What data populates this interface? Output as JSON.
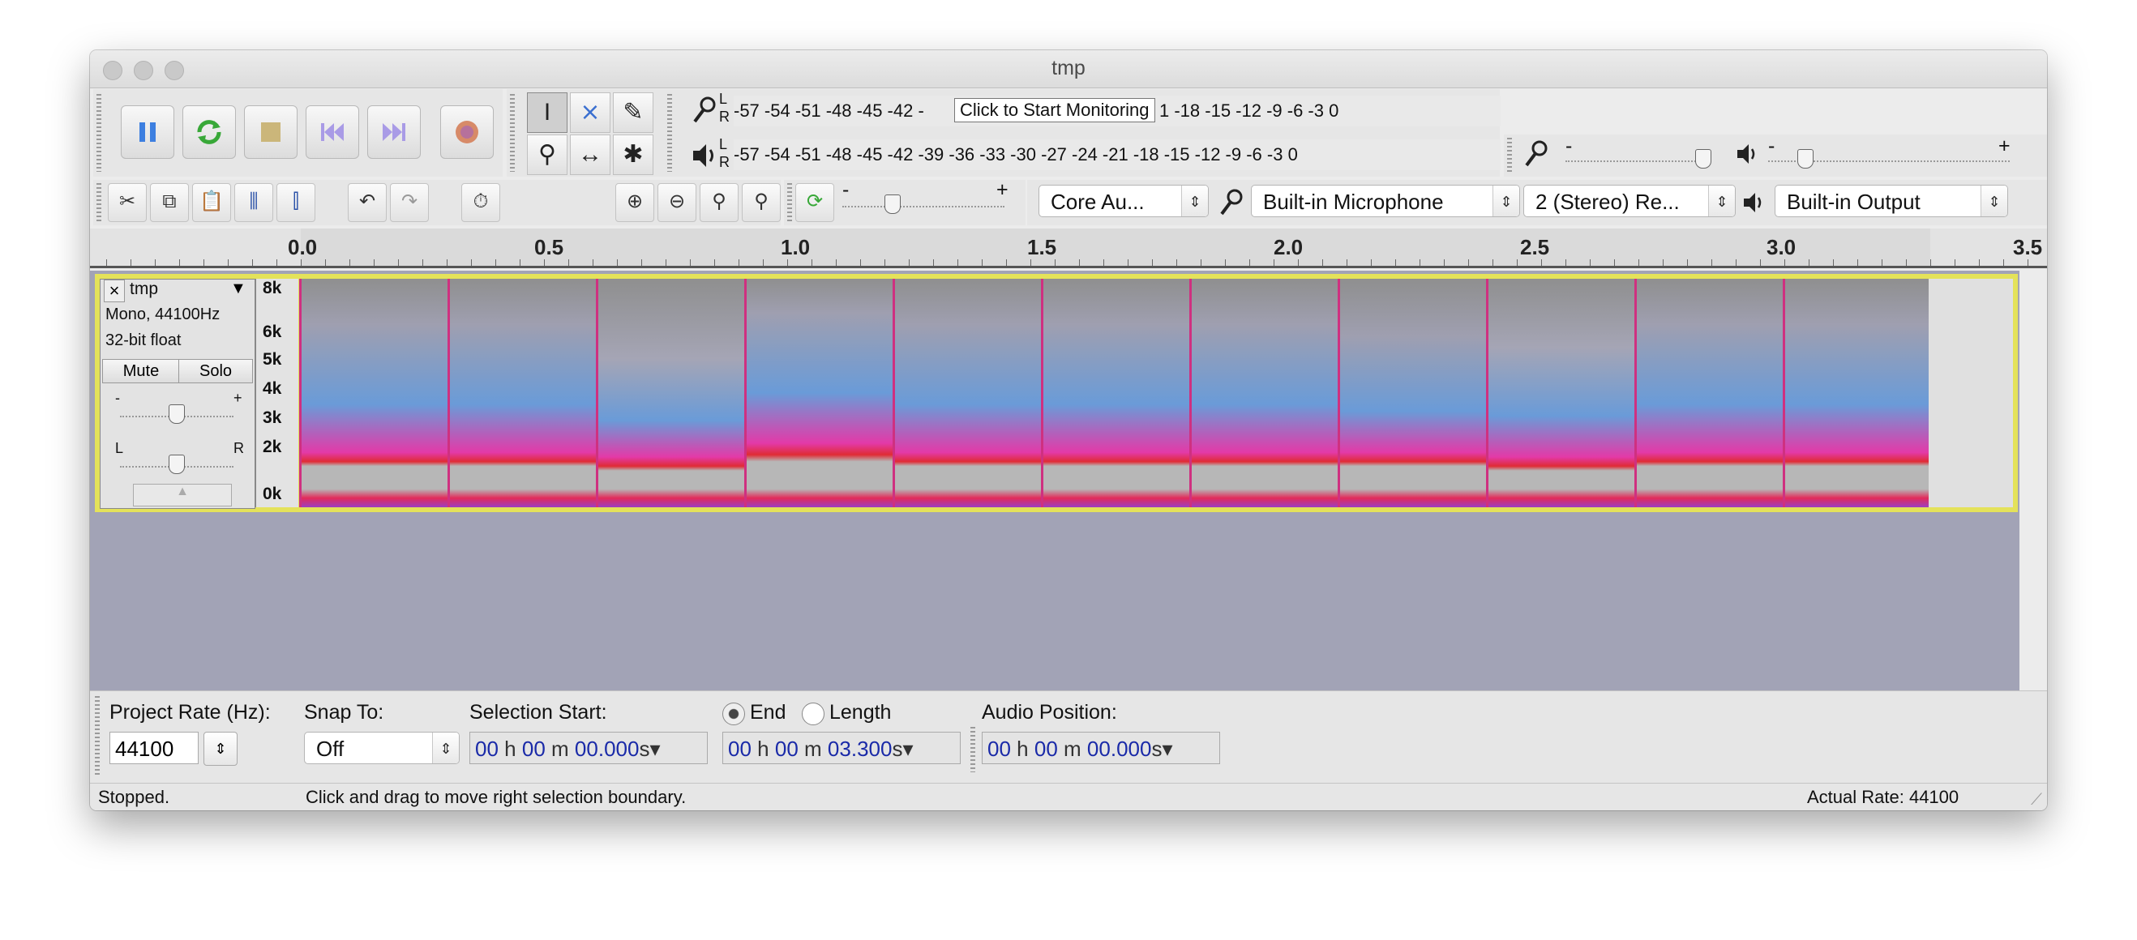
{
  "window": {
    "title": "tmp"
  },
  "transport": {
    "buttons": [
      {
        "name": "pause-button",
        "icon": "pause-icon"
      },
      {
        "name": "play-button",
        "icon": "play-loop-icon"
      },
      {
        "name": "stop-button",
        "icon": "stop-icon"
      },
      {
        "name": "skip-start-button",
        "icon": "skip-to-start-icon"
      },
      {
        "name": "skip-end-button",
        "icon": "skip-to-end-icon"
      },
      {
        "name": "record-button",
        "icon": "record-icon"
      }
    ]
  },
  "meters": {
    "record_scale": "-57 -54 -51 -48 -45 -42 -",
    "record_scale_tail": "1 -18 -15 -12 -9 -6 -3 0",
    "record_tooltip": "Click to Start Monitoring",
    "play_scale": "-57 -54 -51 -48 -45 -42 -39 -36 -33 -30 -27 -24 -21 -18 -15 -12 -9 -6 -3 0",
    "channel_l": "L",
    "channel_r": "R"
  },
  "mixer": {
    "minus": "-",
    "plus": "+"
  },
  "device": {
    "host": "Core Au...",
    "input": "Built-in Microphone",
    "channels": "2 (Stereo) Re...",
    "output": "Built-in Output"
  },
  "ruler": {
    "labels": [
      "0.0",
      "0.5",
      "1.0",
      "1.5",
      "2.0",
      "2.5",
      "3.0",
      "3.5"
    ]
  },
  "track": {
    "name": "tmp",
    "info1": "Mono, 44100Hz",
    "info2": "32-bit float",
    "mute": "Mute",
    "solo": "Solo",
    "gain_minus": "-",
    "gain_plus": "+",
    "pan_left": "L",
    "pan_right": "R",
    "scale": [
      "8k",
      "6k",
      "5k",
      "4k",
      "3k",
      "2k",
      "0k"
    ]
  },
  "selection": {
    "project_rate_label": "Project Rate (Hz):",
    "project_rate": "44100",
    "snap_label": "Snap To:",
    "snap_value": "Off",
    "start_label": "Selection Start:",
    "end_option": "End",
    "length_option": "Length",
    "start_h": "00",
    "start_m": "00",
    "start_s": "00.000",
    "end_h": "00",
    "end_m": "00",
    "end_s": "03.300",
    "audio_position_label": "Audio Position:",
    "pos_h": "00",
    "pos_m": "00",
    "pos_s": "00.000",
    "unit_h": "h",
    "unit_m": "m",
    "unit_s": "s"
  },
  "status": {
    "state": "Stopped.",
    "hint": "Click and drag to move right selection boundary.",
    "rate": "Actual Rate: 44100"
  }
}
